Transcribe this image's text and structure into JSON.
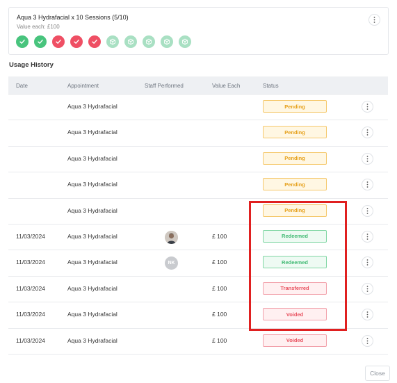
{
  "package": {
    "title": "Aqua 3 Hydrafacial x 10 Sessions (5/10)",
    "value_label": "Value each: £100",
    "sessions": [
      "redeemed",
      "redeemed",
      "voided",
      "voided",
      "voided",
      "available",
      "available",
      "available",
      "available",
      "available"
    ]
  },
  "usage": {
    "title": "Usage History",
    "columns": [
      "Date",
      "Appointment",
      "Staff Performed",
      "Value Each",
      "Status"
    ],
    "rows": [
      {
        "date": "",
        "appointment": "Aqua 3 Hydrafacial",
        "staff": "",
        "value": "",
        "status": "Pending",
        "status_type": "pending"
      },
      {
        "date": "",
        "appointment": "Aqua 3 Hydrafacial",
        "staff": "",
        "value": "",
        "status": "Pending",
        "status_type": "pending"
      },
      {
        "date": "",
        "appointment": "Aqua 3 Hydrafacial",
        "staff": "",
        "value": "",
        "status": "Pending",
        "status_type": "pending"
      },
      {
        "date": "",
        "appointment": "Aqua 3 Hydrafacial",
        "staff": "",
        "value": "",
        "status": "Pending",
        "status_type": "pending"
      },
      {
        "date": "",
        "appointment": "Aqua 3 Hydrafacial",
        "staff": "",
        "value": "",
        "status": "Pending",
        "status_type": "pending"
      },
      {
        "date": "11/03/2024",
        "appointment": "Aqua 3 Hydrafacial",
        "staff": "photo",
        "value": "£ 100",
        "status": "Redeemed",
        "status_type": "redeemed"
      },
      {
        "date": "11/03/2024",
        "appointment": "Aqua 3 Hydrafacial",
        "staff": "NK",
        "value": "£ 100",
        "status": "Redeemed",
        "status_type": "redeemed"
      },
      {
        "date": "11/03/2024",
        "appointment": "Aqua 3 Hydrafacial",
        "staff": "",
        "value": "£ 100",
        "status": "Transferred",
        "status_type": "transferred"
      },
      {
        "date": "11/03/2024",
        "appointment": "Aqua 3 Hydrafacial",
        "staff": "",
        "value": "£ 100",
        "status": "Voided",
        "status_type": "voided"
      },
      {
        "date": "11/03/2024",
        "appointment": "Aqua 3 Hydrafacial",
        "staff": "",
        "value": "£ 100",
        "status": "Voided",
        "status_type": "voided"
      }
    ]
  },
  "footer": {
    "close_label": "Close"
  },
  "colors": {
    "redeemed": "#48c47d",
    "voided": "#ef4f64",
    "available": "#a9e0c3",
    "pending": "#e6a11c",
    "highlight": "#e02020"
  }
}
